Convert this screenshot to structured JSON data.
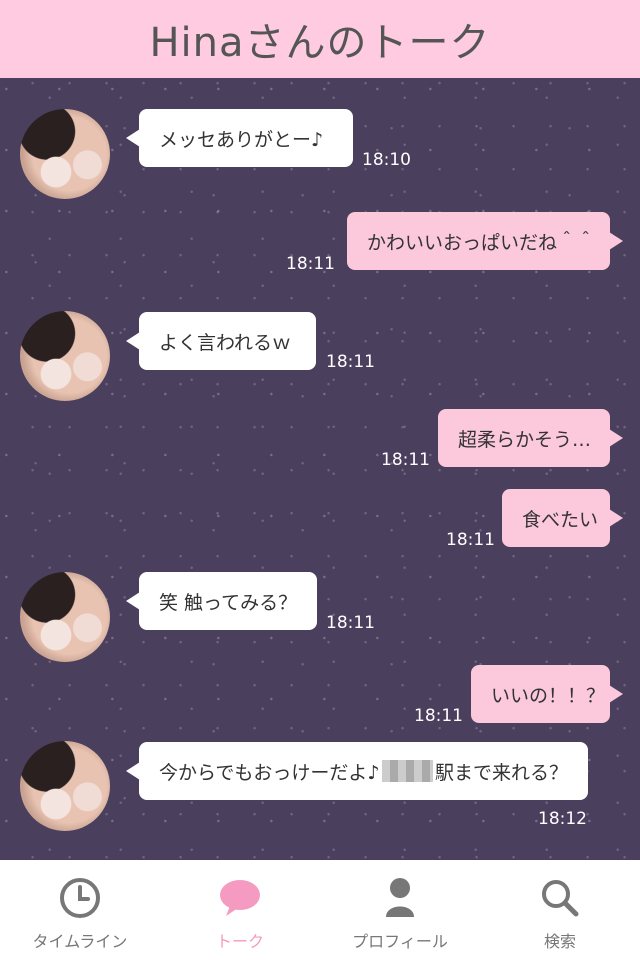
{
  "header": {
    "title": "Hinaさんのトーク"
  },
  "messages": [
    {
      "text": "メッセありがとー♪",
      "time": "18:10"
    },
    {
      "text": "かわいいおっぱいだね＾＾",
      "time": "18:11"
    },
    {
      "text": "よく言われるｗ",
      "time": "18:11"
    },
    {
      "text": "超柔らかそう…",
      "time": "18:11"
    },
    {
      "text": "食べたい",
      "time": "18:11"
    },
    {
      "text": "笑 触ってみる？",
      "time": "18:11"
    },
    {
      "text": "いいの！！？",
      "time": "18:11"
    },
    {
      "text_before": "今からでもおっけーだよ♪",
      "text_after": "駅まで来れる？",
      "time": "18:12"
    }
  ],
  "tabbar": {
    "items": [
      {
        "label": "タイムライン",
        "icon": "clock-icon"
      },
      {
        "label": "トーク",
        "icon": "speech-bubble-icon"
      },
      {
        "label": "プロフィール",
        "icon": "person-icon"
      },
      {
        "label": "検索",
        "icon": "search-icon"
      }
    ],
    "active_index": 1,
    "active_color": "#f59ac0"
  },
  "colors": {
    "header_bg": "#fecbe0",
    "mine_bubble": "#fcc9dc",
    "chat_bg": "#4b3f5e"
  }
}
